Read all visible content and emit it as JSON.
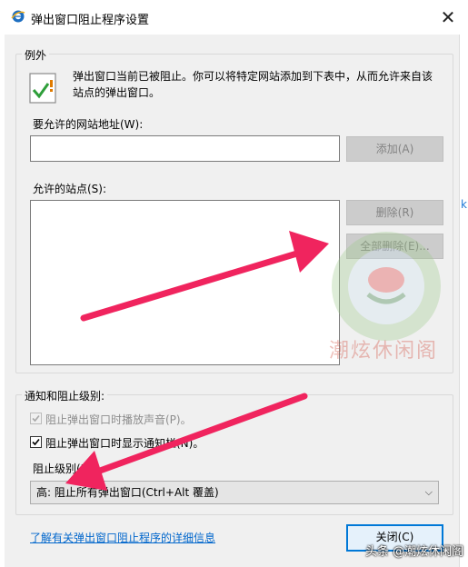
{
  "window": {
    "title": "弹出窗口阻止程序设置",
    "close_glyph": "✕"
  },
  "exceptions": {
    "group_label": "例外",
    "info_text": "弹出窗口当前已被阻止。你可以将特定网站添加到下表中，从而允许来自该站点的弹出窗口。",
    "address_label": "要允许的网站地址(W):",
    "address_value": "",
    "add_button": "添加(A)",
    "allowed_sites_label": "允许的站点(S):",
    "allowed_sites": [],
    "remove_button": "删除(R)",
    "remove_all_button": "全部删除(E)..."
  },
  "notifications": {
    "group_label": "通知和阻止级别:",
    "play_sound_label": "阻止弹出窗口时播放声音(P)。",
    "play_sound_checked": true,
    "play_sound_enabled": false,
    "show_bar_label": "阻止弹出窗口时显示通知栏(N)。",
    "show_bar_checked": true,
    "level_label": "阻止级别(B):",
    "level_value": "高: 阻止所有弹出窗口(Ctrl+Alt 覆盖)"
  },
  "footer": {
    "learn_more_link": "了解有关弹出窗口阻止程序的详细信息",
    "close_button": "关闭(C)"
  },
  "overlay": {
    "watermark_text": "潮炫休闲阁",
    "credit_text": "头条 @潮炫休闲阁",
    "arrow_color": "#f0245e",
    "background_edge_text": "k"
  },
  "colors": {
    "accent": "#0078d7",
    "link": "#0066cc",
    "dialog_bg": "#f0f0f0"
  }
}
